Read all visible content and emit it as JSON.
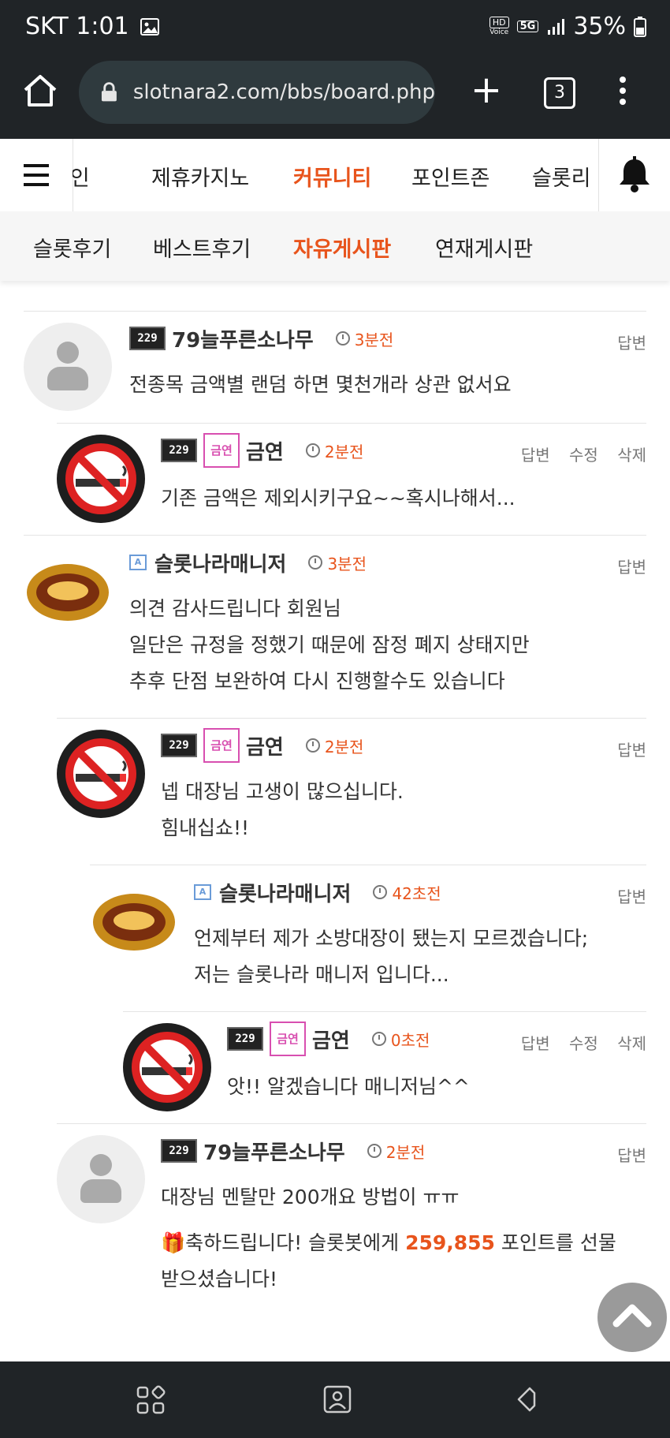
{
  "status": {
    "carrier_time": "SKT 1:01",
    "hd_label": "HD",
    "voice_label": "Voice",
    "net": "5G",
    "battery": "35%"
  },
  "browser": {
    "url": "slotnara2.com/bbs/board.php",
    "tab_count": "3"
  },
  "main_nav": [
    "메인",
    "제휴카지노",
    "커뮤니티",
    "포인트존",
    "슬롯리"
  ],
  "main_nav_active": "커뮤니티",
  "sub_nav": [
    "슬롯후기",
    "베스트후기",
    "자유게시판",
    "연재게시판"
  ],
  "sub_nav_active": "자유게시판",
  "actions": {
    "reply": "답변",
    "edit": "수정",
    "delete": "삭제"
  },
  "badges": {
    "level": "229",
    "smoke": "금연",
    "admin": "A"
  },
  "comments": [
    {
      "nick": "79늘푸른소나무",
      "time": "3분전",
      "lines": [
        "전종목 금액별  랜덤 하면 몇천개라 상관 없서요"
      ]
    },
    {
      "nick": "금연",
      "time": "2분전",
      "lines": [
        "기존 금액은 제외시키구요~~혹시나해서..."
      ]
    },
    {
      "nick": "슬롯나라매니저",
      "time": "3분전",
      "lines": [
        "의견 감사드립니다 회원님",
        "일단은 규정을 정했기 때문에 잠정 폐지 상태지만",
        "추후 단점 보완하여 다시 진행할수도 있습니다"
      ]
    },
    {
      "nick": "금연",
      "time": "2분전",
      "lines": [
        "넵 대장님 고생이 많으십니다.",
        "힘내십쇼!!"
      ]
    },
    {
      "nick": "슬롯나라매니저",
      "time": "42초전",
      "lines": [
        "언제부터 제가 소방대장이 됐는지 모르겠습니다;",
        "저는 슬롯나라 매니저 입니다..."
      ]
    },
    {
      "nick": "금연",
      "time": "0초전",
      "lines": [
        "앗!! 알겠습니다 매니저님^^"
      ]
    },
    {
      "nick": "79늘푸른소나무",
      "time": "2분전",
      "lines": [
        "대장님 멘탈만 200개요 방법이 ㅠㅠ"
      ]
    }
  ],
  "gift": {
    "prefix": "축하드립니다! 슬롯봇에게 ",
    "points": "259,855",
    "suffix": " 포인트를 선물",
    "line2": "받으셨습니다!"
  },
  "colors": {
    "accent": "#e8541c",
    "dark_bar": "#202427"
  }
}
